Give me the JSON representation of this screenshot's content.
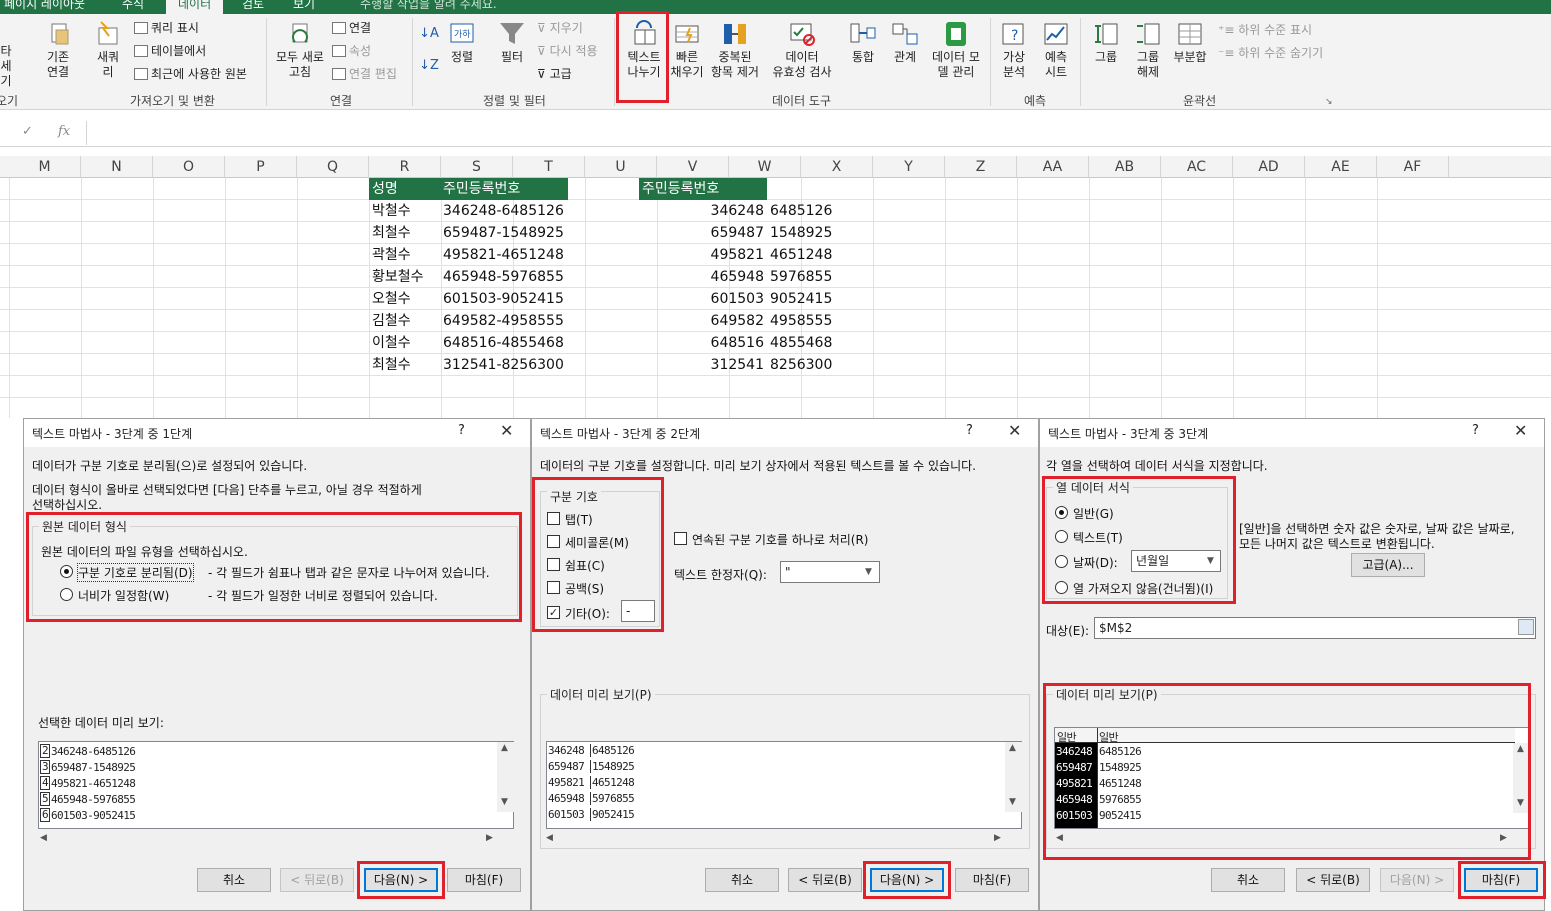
{
  "ribbon_tabs": [
    "페이지 레이아웃",
    "수식",
    "데이터",
    "검토",
    "보기",
    "수행할 작업을 알려 주세요."
  ],
  "ribbon": {
    "btn_partial_left": "타\n세기",
    "existing": "기존\n연결",
    "new_query": "새쿼\n리",
    "show_query": "쿼리 표시",
    "from_table": "테이블에서",
    "recent_sources": "최근에 사용한 원본",
    "refresh_all": "모두 새로\n고침",
    "connections": "연결",
    "properties": "속성",
    "edit_links": "연결 편집",
    "sort": "정렬",
    "filter": "필터",
    "clear": "지우기",
    "reapply": "다시 적용",
    "advanced": "고급",
    "text_to_columns": "텍스트\n나누기",
    "flash_fill": "빠른\n채우기",
    "remove_dup": "중복된\n항목 제거",
    "validation": "데이터\n유효성 검사",
    "consolidate": "통합",
    "relations": "관계",
    "data_model": "데이터 모\n델 관리",
    "whatif": "가상\n분석",
    "forecast": "예측\n시트",
    "group": "그룹",
    "ungroup": "그룹\n해제",
    "subtotal": "부분합",
    "show_detail": "하위 수준 표시",
    "hide_detail": "하위 수준 숨기기",
    "groups": [
      "가져오기 및 변환",
      "연결",
      "정렬 및 필터",
      "데이터 도구",
      "예측",
      "윤곽선"
    ],
    "group_partial": "오기"
  },
  "formula_bar": {
    "fx": "fx"
  },
  "columns": [
    "M",
    "N",
    "O",
    "P",
    "Q",
    "R",
    "S",
    "T",
    "U",
    "V",
    "W",
    "X",
    "Y",
    "Z",
    "AA",
    "AB",
    "AC",
    "AD",
    "AE",
    "AF"
  ],
  "table1": {
    "header_name": "성명",
    "header_id": "주민등록번호",
    "rows": [
      [
        "박철수",
        "346248-6485126"
      ],
      [
        "최철수",
        "659487-1548925"
      ],
      [
        "곽철수",
        "495821-4651248"
      ],
      [
        "황보철수",
        "465948-5976855"
      ],
      [
        "오철수",
        "601503-9052415"
      ],
      [
        "김철수",
        "649582-4958555"
      ],
      [
        "이철수",
        "648516-4855468"
      ],
      [
        "최철수",
        "312541-8256300"
      ]
    ]
  },
  "table2": {
    "header": "주민등록번호",
    "rows": [
      [
        "346248",
        "6485126"
      ],
      [
        "659487",
        "1548925"
      ],
      [
        "495821",
        "4651248"
      ],
      [
        "465948",
        "5976855"
      ],
      [
        "601503",
        "9052415"
      ],
      [
        "649582",
        "4958555"
      ],
      [
        "648516",
        "4855468"
      ],
      [
        "312541",
        "8256300"
      ]
    ]
  },
  "dlg1": {
    "title": "텍스트 마법사 - 3단계 중 1단계",
    "q": "?",
    "x": "✕",
    "line1": "데이터가 구분 기호로 분리됨(으)로 설정되어 있습니다.",
    "line2": "데이터 형식이 올바로 선택되었다면 [다음] 단추를 누르고, 아닐 경우 적절하게",
    "line3": "선택하십시오.",
    "group": "원본 데이터 형식",
    "group_desc": "원본 데이터의 파일 유형을 선택하십시오.",
    "opt1": "구분 기호로 분리됨(D)",
    "opt1_desc": "- 각 필드가 쉼표나 탭과 같은 문자로 나누어져 있습니다.",
    "opt2": "너비가 일정함(W)",
    "opt2_desc": "- 각 필드가 일정한 너비로 정렬되어 있습니다.",
    "preview_label": "선택한 데이터 미리 보기:",
    "preview": [
      [
        "2",
        "346248-6485126"
      ],
      [
        "3",
        "659487-1548925"
      ],
      [
        "4",
        "495821-4651248"
      ],
      [
        "5",
        "465948-5976855"
      ],
      [
        "6",
        "601503-9052415"
      ]
    ],
    "cancel": "취소",
    "back": "< 뒤로(B)",
    "next": "다음(N) >",
    "finish": "마침(F)"
  },
  "dlg2": {
    "title": "텍스트 마법사 - 3단계 중 2단계",
    "q": "?",
    "x": "✕",
    "line1": "데이터의 구분 기호를 설정합니다. 미리 보기 상자에서 적용된 텍스트를 볼 수 있습니다.",
    "group": "구분 기호",
    "tab": "탭(T)",
    "semicolon": "세미콜론(M)",
    "comma": "쉼표(C)",
    "space": "공백(S)",
    "other": "기타(O):",
    "other_value": "-",
    "consecutive": "연속된 구분 기호를 하나로 처리(R)",
    "qualifier_label": "텍스트 한정자(Q):",
    "qualifier_value": "\"",
    "preview_label": "데이터 미리 보기(P)",
    "preview": [
      [
        "346248",
        "6485126"
      ],
      [
        "659487",
        "1548925"
      ],
      [
        "495821",
        "4651248"
      ],
      [
        "465948",
        "5976855"
      ],
      [
        "601503",
        "9052415"
      ]
    ],
    "cancel": "취소",
    "back": "< 뒤로(B)",
    "next": "다음(N) >",
    "finish": "마침(F)"
  },
  "dlg3": {
    "title": "텍스트 마법사 - 3단계 중 3단계",
    "q": "?",
    "x": "✕",
    "line1": "각 열을 선택하여 데이터 서식을 지정합니다.",
    "group": "열 데이터 서식",
    "general": "일반(G)",
    "text": "텍스트(T)",
    "date": "날짜(D):",
    "date_value": "년월일",
    "skip": "열 가져오지 않음(건너뜀)(I)",
    "desc1": "[일반]을 선택하면 숫자 값은 숫자로, 날짜 값은 날짜로,",
    "desc2": "모든 나머지 값은 텍스트로 변환됩니다.",
    "advanced": "고급(A)...",
    "dest_label": "대상(E):",
    "dest_value": "$M$2",
    "preview_label": "데이터 미리 보기(P)",
    "col_h1": "일반",
    "col_h2": "일반",
    "preview": [
      [
        "346248",
        "6485126"
      ],
      [
        "659487",
        "1548925"
      ],
      [
        "495821",
        "4651248"
      ],
      [
        "465948",
        "5976855"
      ],
      [
        "601503",
        "9052415"
      ]
    ],
    "cancel": "취소",
    "back": "< 뒤로(B)",
    "next": "다음(N) >",
    "finish": "마침(F)"
  }
}
